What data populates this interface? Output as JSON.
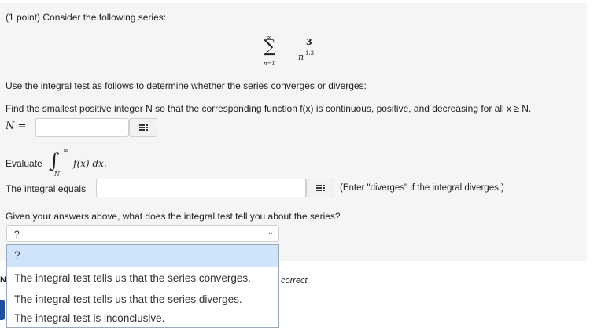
{
  "problem": {
    "intro": "(1 point) Consider the following series:",
    "series": {
      "upper": "∞",
      "lower": "n=1",
      "numerator": "3",
      "denominator_base": "n",
      "denominator_exp": "1.3"
    },
    "instruction": "Use the integral test as follows to determine whether the series converges or diverges:",
    "find_text": "Find the smallest positive integer N so that the corresponding function f(x) is continuous, positive, and decreasing for all x ≥ N.",
    "n_label": "N =",
    "evaluate_label": "Evaluate",
    "integral_upper": "∞",
    "integral_lower": "N",
    "integrand": "f(x) dx.",
    "integral_equals_label": "The integral equals",
    "integral_hint": "(Enter \"diverges\" if the integral diverges.)",
    "question": "Given your answers above, what does the integral test tell you about the series?"
  },
  "select": {
    "value": "?",
    "options": [
      "?",
      "The integral test tells us that the series converges.",
      "The integral test tells us that the series diverges.",
      "The integral test is inconclusive."
    ]
  },
  "behind": {
    "left_char": "N",
    "text": "correct."
  }
}
